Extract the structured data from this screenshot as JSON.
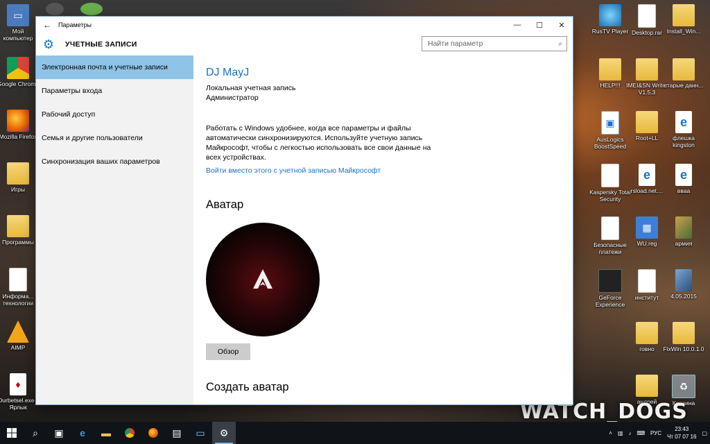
{
  "desktop": {
    "left_icons": [
      {
        "label": "Мой компьютер",
        "icon": "computer-icon"
      },
      {
        "label": "Google Chrome",
        "icon": "chrome-icon"
      },
      {
        "label": "Mozilla Firefox",
        "icon": "firefox-icon"
      },
      {
        "label": "Игры",
        "icon": "folder-icon"
      },
      {
        "label": "Программы",
        "icon": "folder-icon"
      },
      {
        "label": "Информа... технологии",
        "icon": "document-icon"
      },
      {
        "label": "AIMP",
        "icon": "aimp-icon"
      },
      {
        "label": "Durbetsel.exe - Ярлык",
        "icon": "cards-icon"
      }
    ],
    "right_icons": [
      {
        "label": "RusTV Player",
        "icon": "disc-icon"
      },
      {
        "label": "Desktop.rar",
        "icon": "document-icon"
      },
      {
        "label": "Install_Win...",
        "icon": "folder-icon"
      },
      {
        "label": "HELP!!!",
        "icon": "folder-icon"
      },
      {
        "label": "IMEI&SN Writer V1.5.3",
        "icon": "folder-icon"
      },
      {
        "label": "старые данн...",
        "icon": "folder-icon"
      },
      {
        "label": "AusLogics BoostSpeed",
        "icon": "app-icon"
      },
      {
        "label": "Root+LL",
        "icon": "folder-icon"
      },
      {
        "label": "флешка kingston",
        "icon": "ie-icon"
      },
      {
        "label": "Kaspersky Total Security",
        "icon": "document-icon"
      },
      {
        "label": "rsload.net....",
        "icon": "ie-icon"
      },
      {
        "label": "вваа",
        "icon": "ie-icon"
      },
      {
        "label": "Безопасные платежи",
        "icon": "document-icon"
      },
      {
        "label": "WU.reg",
        "icon": "reg-icon"
      },
      {
        "label": "армия",
        "icon": "image-icon"
      },
      {
        "label": "GeForce Experience",
        "icon": "nvidia-icon"
      },
      {
        "label": "институт",
        "icon": "document-icon"
      },
      {
        "label": "4.05.2015",
        "icon": "image-icon"
      },
      {
        "label": "говно",
        "icon": "folder-icon"
      },
      {
        "label": "FixWin 10.0.1.0",
        "icon": "folder-icon"
      },
      {
        "label": "андрей",
        "icon": "folder-icon"
      },
      {
        "label": "Корзина",
        "icon": "recycle-bin-icon"
      }
    ],
    "wallpaper_text": "WATCH_DOGS"
  },
  "window": {
    "title": "Параметры",
    "section_title": "УЧЕТНЫЕ ЗАПИСИ",
    "search_placeholder": "Найти параметр",
    "nav": [
      {
        "label": "Электронная почта и учетные записи",
        "active": true
      },
      {
        "label": "Параметры входа",
        "active": false
      },
      {
        "label": "Рабочий доступ",
        "active": false
      },
      {
        "label": "Семья и другие пользователи",
        "active": false
      },
      {
        "label": "Синхронизация ваших параметров",
        "active": false
      }
    ],
    "content": {
      "user_name": "DJ MayJ",
      "account_type": "Локальная учетная запись",
      "role": "Администратор",
      "info_text": "Работать с Windows удобнее, когда все параметры и файлы автоматически синхронизируются. Используйте учетную запись Майкрософт, чтобы с легкостью использовать все свои данные на всех устройствах.",
      "ms_link": "Войти вместо этого с учетной записью Майкрософт",
      "avatar_heading": "Аватар",
      "browse_button": "Обзор",
      "create_avatar_heading": "Создать аватар"
    }
  },
  "taskbar": {
    "language": "РУС",
    "time": "23:43",
    "date": "Чт 07 07 16"
  },
  "colors": {
    "accent": "#1a73c8",
    "nav_active": "#8fc3e8",
    "sidebar_bg": "#f2f2f2",
    "taskbar_bg": "#101418"
  }
}
